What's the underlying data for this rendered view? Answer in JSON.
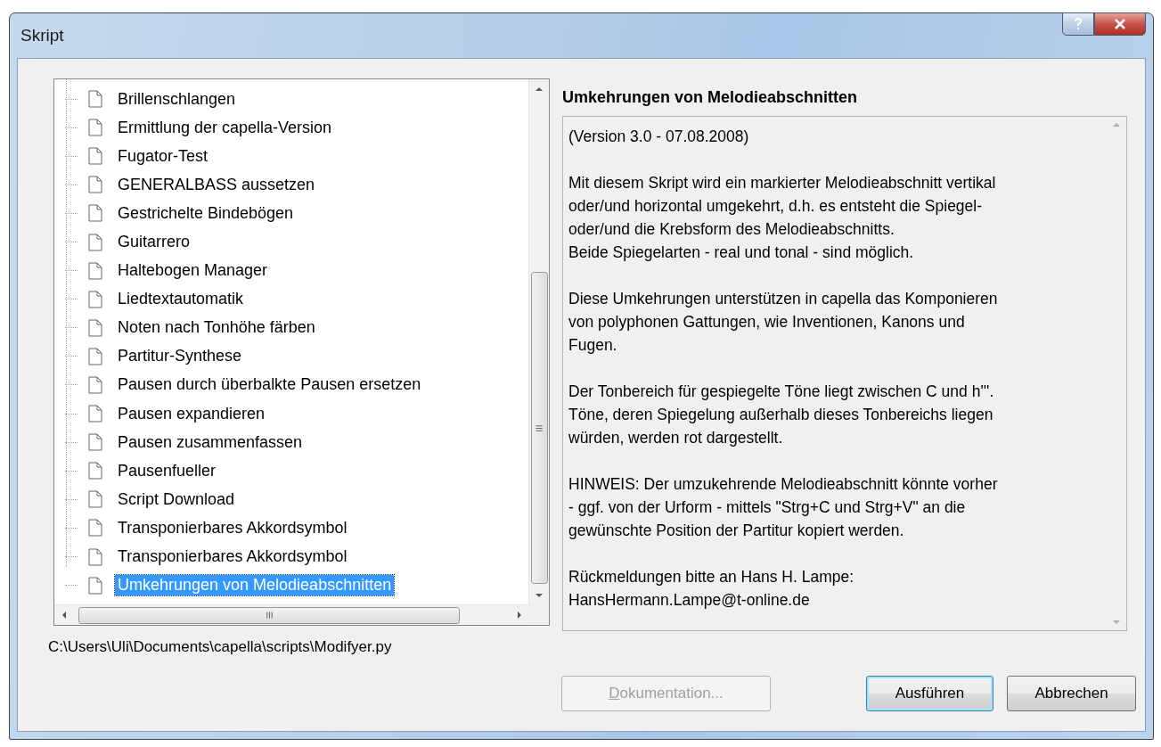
{
  "window": {
    "title": "Skript"
  },
  "tree": {
    "items": [
      {
        "label": "Brillenschlangen",
        "selected": false
      },
      {
        "label": "Ermittlung der capella-Version",
        "selected": false
      },
      {
        "label": "Fugator-Test",
        "selected": false
      },
      {
        "label": "GENERALBASS aussetzen",
        "selected": false
      },
      {
        "label": "Gestrichelte Bindebögen",
        "selected": false
      },
      {
        "label": "Guitarrero",
        "selected": false
      },
      {
        "label": "Haltebogen Manager",
        "selected": false
      },
      {
        "label": "Liedtextautomatik",
        "selected": false
      },
      {
        "label": "Noten nach Tonhöhe färben",
        "selected": false
      },
      {
        "label": "Partitur-Synthese",
        "selected": false
      },
      {
        "label": "Pausen durch überbalkte Pausen ersetzen",
        "selected": false
      },
      {
        "label": "Pausen expandieren",
        "selected": false
      },
      {
        "label": "Pausen zusammenfassen",
        "selected": false
      },
      {
        "label": "Pausenfueller",
        "selected": false
      },
      {
        "label": "Script Download",
        "selected": false
      },
      {
        "label": "Transponierbares Akkordsymbol",
        "selected": false
      },
      {
        "label": "Transponierbares Akkordsymbol",
        "selected": false
      },
      {
        "label": "Umkehrungen von Melodieabschnitten",
        "selected": true
      }
    ]
  },
  "description": {
    "title": "Umkehrungen von Melodieabschnitten",
    "paragraphs": [
      [
        "(Version 3.0 - 07.08.2008)"
      ],
      [
        "Mit diesem Skript wird ein markierter Melodieabschnitt vertikal",
        "oder/und horizontal umgekehrt, d.h. es entsteht die Spiegel-",
        "oder/und die Krebsform des Melodieabschnitts.",
        "Beide Spiegelarten - real und tonal - sind möglich."
      ],
      [
        "Diese Umkehrungen unterstützen in capella das Komponieren",
        "von polyphonen Gattungen, wie Inventionen, Kanons und",
        "Fugen."
      ],
      [
        "Der Tonbereich für gespiegelte Töne liegt zwischen C und h'''.",
        "Töne, deren Spiegelung außerhalb dieses Tonbereichs liegen",
        "würden, werden rot dargestellt."
      ],
      [
        "HINWEIS: Der umzukehrende Melodieabschnitt könnte vorher",
        "- ggf. von der Urform - mittels \"Strg+C und Strg+V\" an die",
        "gewünschte Position der Partitur kopiert werden."
      ],
      [
        "Rückmeldungen bitte an Hans H. Lampe:",
        "HansHermann.Lampe@t-online.de"
      ]
    ]
  },
  "path": "C:\\Users\\Uli\\Documents\\capella\\scripts\\Modifyer.py",
  "buttons": [
    {
      "label": "Dokumentation...",
      "disabled": true,
      "default": false
    },
    {
      "label": "Ausführen",
      "disabled": false,
      "default": true
    },
    {
      "label": "Abbrechen",
      "disabled": false,
      "default": false
    }
  ]
}
